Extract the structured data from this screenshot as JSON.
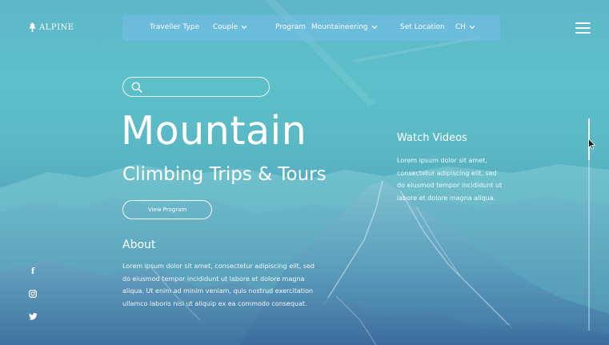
{
  "brand": {
    "logo_text": "ALPINE",
    "logo_icon": "tree-icon"
  },
  "filters": {
    "traveller_type_label": "Traveller Type",
    "traveller_type_value": "Couple",
    "program_label": "Program",
    "program_value": "Mountaineering",
    "location_label": "Set Location",
    "location_value": "CH"
  },
  "search": {
    "placeholder": ""
  },
  "hero": {
    "title": "Mountain",
    "subtitle": "Climbing Trips & Tours",
    "button_label": "View Program"
  },
  "about": {
    "title": "About",
    "text": "Lorem ipsum dolor sit amet, consectetur adipiscing elit, sed do eiusmod tempor incididunt ut labore et dolore magna aliqua. Ut enim ad minim veniam, quis nostrud exercitation ullamco laboris nisi ut aliquip ex ea commodo consequat."
  },
  "videos": {
    "title": "Watch Videos",
    "text": "Lorem ipsum dolor sit amet, consectetur adipiscing elit, sed do eiusmod tempor incididunt ut labore et dolore magna aliqua."
  },
  "social": [
    {
      "name": "facebook",
      "icon": "facebook-icon",
      "glyph": "f"
    },
    {
      "name": "instagram",
      "icon": "instagram-icon"
    },
    {
      "name": "twitter",
      "icon": "twitter-icon"
    }
  ],
  "colors": {
    "sky_top": "#5fb6c9",
    "sky_mid": "#5cc0c9",
    "mountain_shadow": "#3d74a2",
    "filter_bar": "#78beeb",
    "text": "#ffffff"
  }
}
